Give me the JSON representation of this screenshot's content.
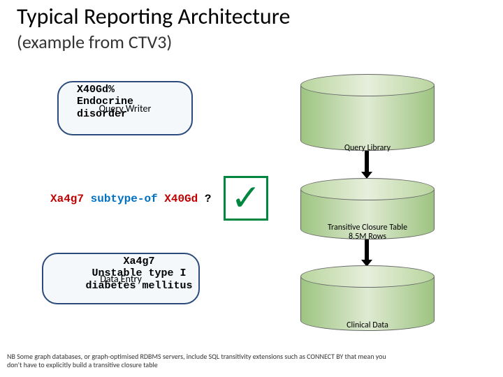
{
  "title": "Typical Reporting Architecture",
  "subtitle": "(example from CTV3)",
  "query_writer": {
    "label": "Query Writer",
    "code_line1": "X40Gd%",
    "code_line2": "Endocrine",
    "code_line3": "disorder"
  },
  "data_entry": {
    "label": "Data Entry",
    "code_line1": "Xa4g7",
    "code_line2": "Unstable type I",
    "code_line3": "diabetes mellitus"
  },
  "expr": {
    "subject": "Xa4g7",
    "relation": "subtype-of",
    "object": "X40Gd",
    "qmark": "?"
  },
  "check": "✓",
  "db": {
    "library": "Query Library",
    "closure_l1": "Transitive Closure Table",
    "closure_l2": "8.5M Rows",
    "clinical": "Clinical Data"
  },
  "footnote": "NB Some graph databases, or graph-optimised RDBMS servers, include SQL transitivity extensions such as CONNECT BY that mean you don't have to explicitly build a transitive closure table"
}
